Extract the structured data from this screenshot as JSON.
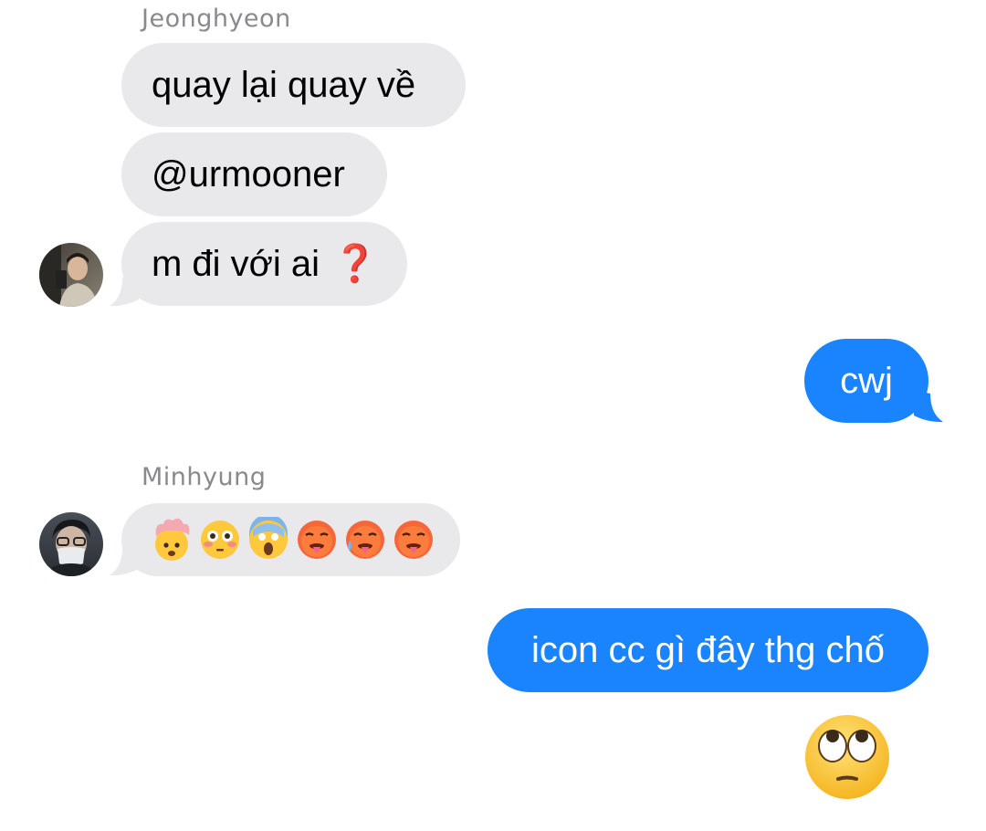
{
  "conversation": {
    "group1": {
      "sender": "Jeonghyeon",
      "messages": [
        "quay lại quay về",
        "@urmooner",
        "m đi với ai"
      ],
      "emoji_after_last": "❓"
    },
    "outgoing1": "cwj",
    "group2": {
      "sender": "Minhyung",
      "emojis": [
        "exploding-head",
        "flushed-face",
        "screaming-face",
        "hot-face",
        "hot-face-sweat",
        "hot-face"
      ]
    },
    "outgoing2": "icon cc gì đây thg chố",
    "outgoing3_emoji": "face-with-rolling-eyes",
    "status_fragment": ""
  },
  "colors": {
    "incoming_bubble": "#e9e9eb",
    "outgoing_bubble": "#1a84ff",
    "sender_name": "#8a8a8e",
    "red_question": "#e21c2b"
  }
}
